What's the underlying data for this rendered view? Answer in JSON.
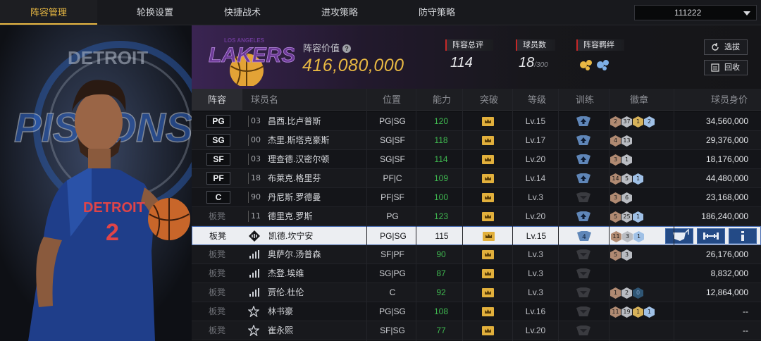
{
  "nav": {
    "tabs": [
      "阵容管理",
      "轮换设置",
      "快捷战术",
      "进攻策略",
      "防守策略"
    ],
    "active_tab": 0,
    "account_value": "111222"
  },
  "team": {
    "lineup_value_label": "阵容价值",
    "lineup_value": "416,080,000",
    "stats": [
      {
        "label": "阵容总评",
        "value": "114"
      },
      {
        "label": "球员数",
        "value": "18",
        "max": "/300"
      },
      {
        "label": "阵容羁绊",
        "value": ""
      }
    ],
    "buttons": {
      "select": "选拔",
      "recycle": "回收"
    },
    "logo_text": "LAKERS",
    "logo_sub": "LOS ANGELES"
  },
  "portrait": {
    "team_text": "DETROIT",
    "jersey_text": "DETROIT",
    "jersey_number": "2",
    "bg_text": "PISTONS"
  },
  "table": {
    "headers": [
      "阵容",
      "球员名",
      "位置",
      "能力",
      "突破",
      "等级",
      "训练",
      "徽章",
      "球员身价"
    ],
    "rows": [
      {
        "slot": "PG",
        "num": "03",
        "name": "昌西.比卢普斯",
        "pos": "PG|SG",
        "ability": "120",
        "level": "Lv.15",
        "train": "up",
        "badges": [
          [
            "b-br",
            "2"
          ],
          [
            "b-si",
            "37"
          ],
          [
            "b-go",
            "1"
          ],
          [
            "b-bl",
            "2"
          ]
        ],
        "value": "34,560,000"
      },
      {
        "slot": "SG",
        "num": "00",
        "name": "杰里.斯塔克豪斯",
        "pos": "SG|SF",
        "ability": "118",
        "level": "Lv.17",
        "train": "up",
        "badges": [
          [
            "b-br",
            "4"
          ],
          [
            "b-si",
            "13"
          ]
        ],
        "value": "29,376,000"
      },
      {
        "slot": "SF",
        "num": "03",
        "name": "理查德.汉密尔顿",
        "pos": "SG|SF",
        "ability": "114",
        "level": "Lv.20",
        "train": "up",
        "badges": [
          [
            "b-br",
            "3"
          ],
          [
            "b-si",
            "1"
          ]
        ],
        "value": "18,176,000"
      },
      {
        "slot": "PF",
        "num": "18",
        "name": "布莱克.格里芬",
        "pos": "PF|C",
        "ability": "109",
        "level": "Lv.14",
        "train": "up",
        "badges": [
          [
            "b-br",
            "14"
          ],
          [
            "b-si",
            "5"
          ],
          [
            "b-bl",
            "1"
          ]
        ],
        "value": "44,480,000"
      },
      {
        "slot": "C",
        "num": "90",
        "name": "丹尼斯.罗德曼",
        "pos": "PF|SF",
        "ability": "100",
        "level": "Lv.3",
        "train": "none",
        "badges": [
          [
            "b-br",
            "3"
          ],
          [
            "b-si",
            "6"
          ]
        ],
        "value": "23,168,000"
      },
      {
        "slot": "板凳",
        "num": "11",
        "name": "德里克.罗斯",
        "pos": "PG",
        "ability": "123",
        "level": "Lv.20",
        "train": "up",
        "badges": [
          [
            "b-br",
            "5"
          ],
          [
            "b-si",
            "25"
          ],
          [
            "b-bl",
            "1"
          ]
        ],
        "value": "186,240,000"
      },
      {
        "slot": "板凳",
        "num": "",
        "name": "凯德.坎宁安",
        "pos": "PG|SG",
        "ability": "115",
        "level": "Lv.15",
        "train": "4",
        "badges": [
          [
            "b-br",
            "11"
          ],
          [
            "b-si",
            "3"
          ],
          [
            "b-bl",
            "1"
          ]
        ],
        "value": "",
        "selected": true
      },
      {
        "slot": "板凳",
        "num": "",
        "name": "奥萨尔.汤普森",
        "pos": "SF|PF",
        "ability": "90",
        "level": "Lv.3",
        "train": "none",
        "badges": [
          [
            "b-br",
            "5"
          ],
          [
            "b-si",
            "3"
          ]
        ],
        "value": "26,176,000"
      },
      {
        "slot": "板凳",
        "num": "",
        "name": "杰登.埃维",
        "pos": "SG|PG",
        "ability": "87",
        "level": "Lv.3",
        "train": "none",
        "badges": [],
        "value": "8,832,000"
      },
      {
        "slot": "板凳",
        "num": "",
        "name": "贾伦.杜伦",
        "pos": "C",
        "ability": "92",
        "level": "Lv.3",
        "train": "none",
        "badges": [
          [
            "b-br",
            "1"
          ],
          [
            "b-si",
            "2"
          ],
          [
            "b-dk",
            "0"
          ]
        ],
        "value": "12,864,000"
      },
      {
        "slot": "板凳",
        "num": "",
        "name": "林书豪",
        "pos": "PG|SG",
        "ability": "108",
        "level": "Lv.16",
        "train": "none",
        "badges": [
          [
            "b-br",
            "11"
          ],
          [
            "b-si",
            "19"
          ],
          [
            "b-go",
            "1"
          ],
          [
            "b-bl",
            "1"
          ]
        ],
        "value": "--"
      },
      {
        "slot": "板凳",
        "num": "",
        "name": "崔永熙",
        "pos": "SF|SG",
        "ability": "77",
        "level": "Lv.20",
        "train": "none",
        "badges": [],
        "value": "--"
      }
    ]
  },
  "colors": {
    "accent": "#e8b843",
    "green": "#3fb950",
    "selected_bg": "#eceef2",
    "action_blue": "#234a86"
  }
}
